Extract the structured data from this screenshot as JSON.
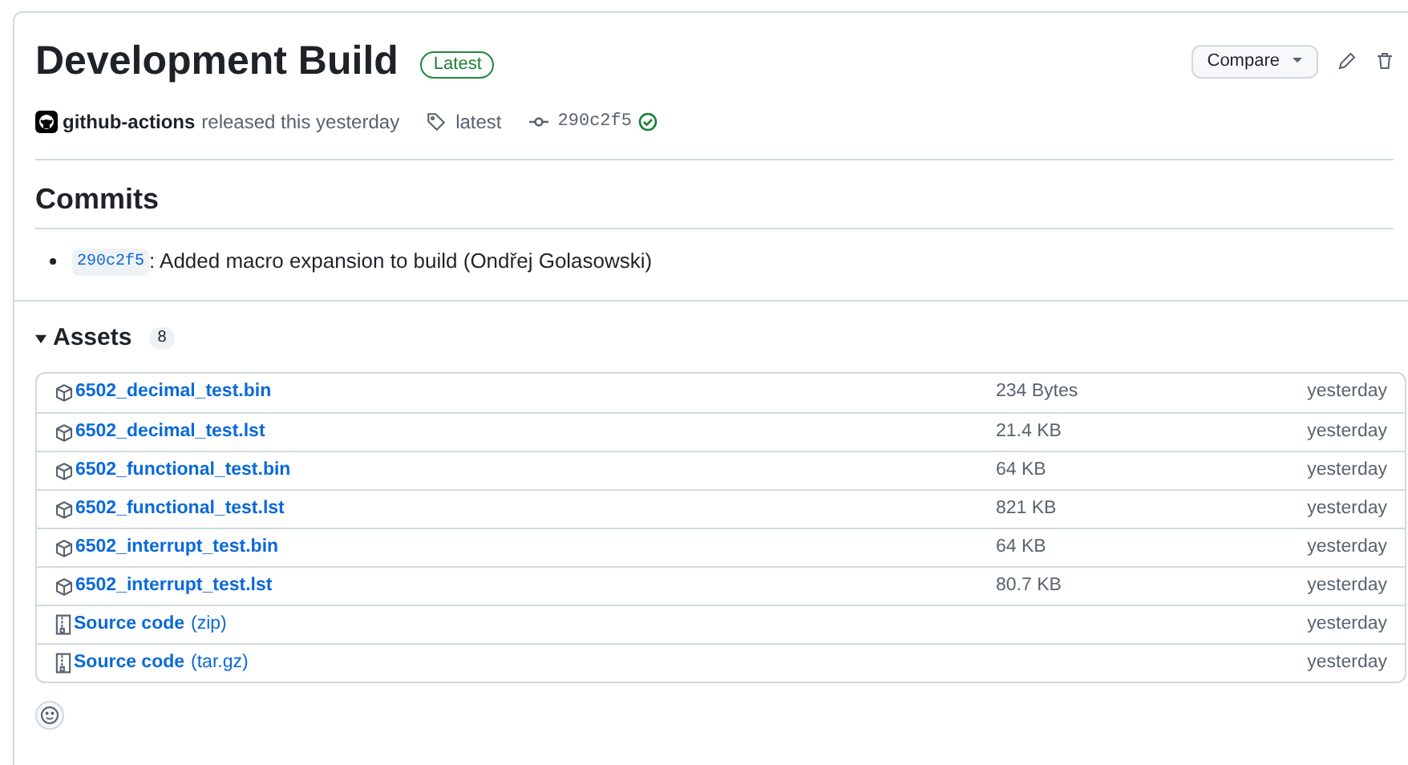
{
  "release": {
    "title": "Development Build",
    "badge": "Latest",
    "author": "github-actions",
    "released": "released this yesterday",
    "tag": "latest",
    "commit": "290c2f5",
    "verified": true
  },
  "actions": {
    "compare": "Compare"
  },
  "commits": {
    "heading": "Commits",
    "items": [
      {
        "sha": "290c2f5",
        "message": ": Added macro expansion to build (Ondřej Golasowski)"
      }
    ]
  },
  "assets": {
    "heading": "Assets",
    "count": "8",
    "expanded": true,
    "items": [
      {
        "kind": "package",
        "name": "6502_decimal_test.bin",
        "size": "234 Bytes",
        "date": "yesterday"
      },
      {
        "kind": "package",
        "name": "6502_decimal_test.lst",
        "size": "21.4 KB",
        "date": "yesterday"
      },
      {
        "kind": "package",
        "name": "6502_functional_test.bin",
        "size": "64 KB",
        "date": "yesterday"
      },
      {
        "kind": "package",
        "name": "6502_functional_test.lst",
        "size": "821 KB",
        "date": "yesterday"
      },
      {
        "kind": "package",
        "name": "6502_interrupt_test.bin",
        "size": "64 KB",
        "date": "yesterday"
      },
      {
        "kind": "package",
        "name": "6502_interrupt_test.lst",
        "size": "80.7 KB",
        "date": "yesterday"
      },
      {
        "kind": "source",
        "name": "Source code",
        "suffix": "(zip)",
        "date": "yesterday"
      },
      {
        "kind": "source",
        "name": "Source code",
        "suffix": "(tar.gz)",
        "date": "yesterday"
      }
    ]
  }
}
